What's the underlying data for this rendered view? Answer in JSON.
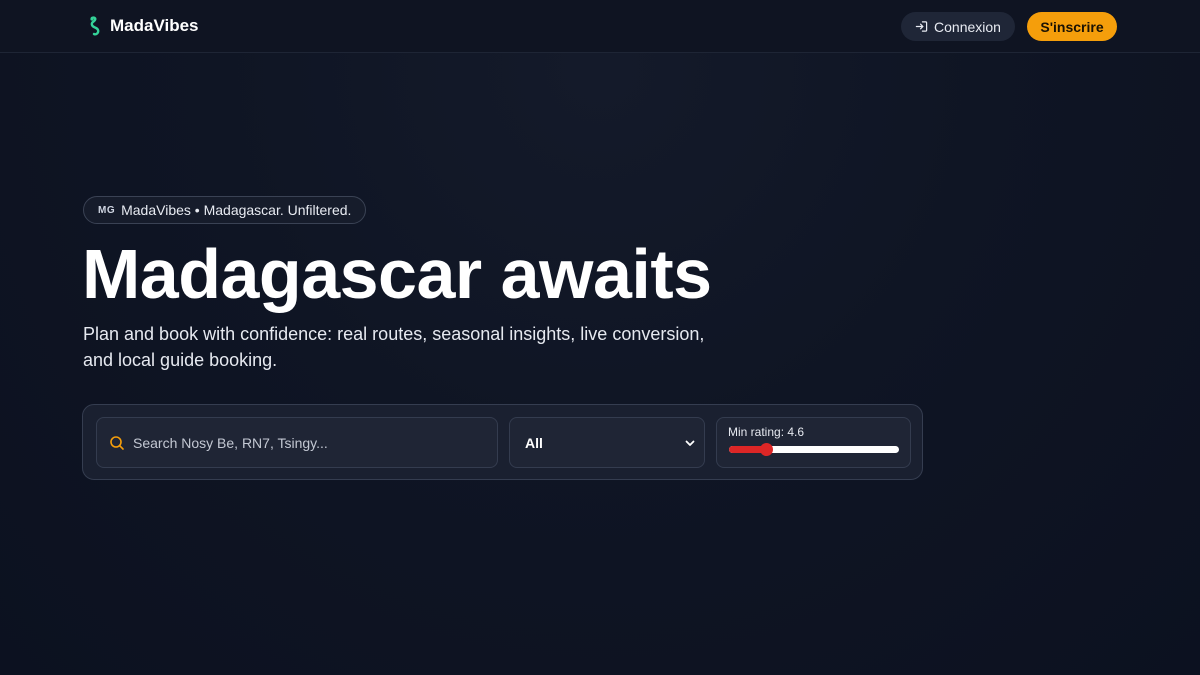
{
  "nav": {
    "brand": "MadaVibes",
    "login_label": "Connexion",
    "signup_label": "S'inscrire"
  },
  "hero": {
    "badge_flag": "MG",
    "badge_text": "MadaVibes • Madagascar. Unfiltered.",
    "title": "Madagascar awaits",
    "subtitle": "Plan and book with confidence: real routes, seasonal insights, live conversion, and local guide booking."
  },
  "search": {
    "placeholder": "Search Nosy Be, RN7, Tsingy...",
    "category_selected": "All",
    "rating_label": "Min rating: 4.6",
    "rating_fraction": 0.22
  },
  "colors": {
    "accent": "#f59e0b",
    "slider": "#dc2626",
    "brand_logo": "#34d399"
  },
  "icons": {
    "brand": "lizard-icon",
    "login": "sign-in-icon",
    "search": "search-icon",
    "select": "chevron-down-icon"
  }
}
